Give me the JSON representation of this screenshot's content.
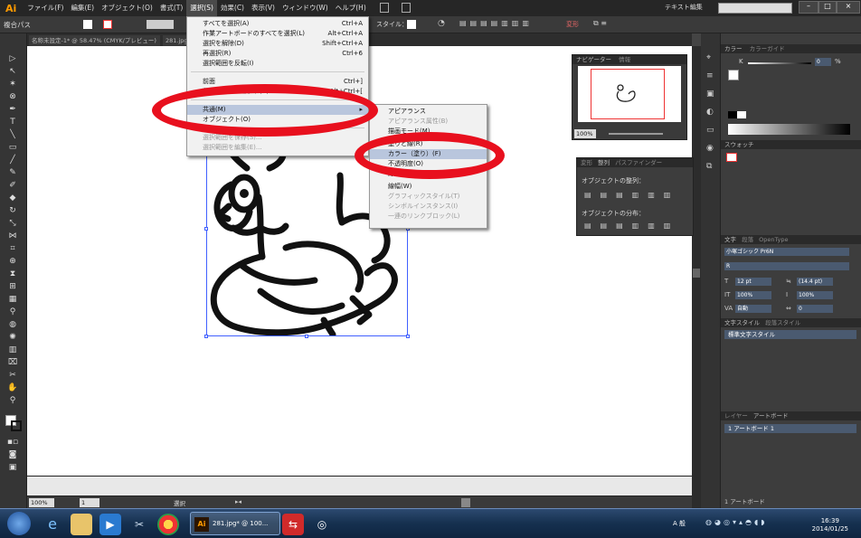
{
  "menubar": {
    "logo": "Ai",
    "items": [
      "ファイル(F)",
      "編集(E)",
      "オブジェクト(O)",
      "書式(T)",
      "選択(S)",
      "効果(C)",
      "表示(V)",
      "ウィンドウ(W)",
      "ヘルプ(H)"
    ],
    "workspace": "テキスト編集",
    "active_index": 4
  },
  "controlbar": {
    "label": "複合パス",
    "style_label": "スタイル：",
    "transform": "変形"
  },
  "document_tabs": [
    "名称未設定-1* @ 58.47% (CMYK/プレビュー)",
    "281.jpg*"
  ],
  "select_menu": {
    "items": [
      {
        "label": "すべてを選択(A)",
        "shortcut": "Ctrl+A"
      },
      {
        "label": "作業アートボードのすべてを選択(L)",
        "shortcut": "Alt+Ctrl+A"
      },
      {
        "label": "選択を解除(D)",
        "shortcut": "Shift+Ctrl+A"
      },
      {
        "label": "再選択(R)",
        "shortcut": "Ctrl+6"
      },
      {
        "label": "選択範囲を反転(I)",
        "shortcut": ""
      },
      {
        "label": "前面",
        "shortcut": "Ctrl+]"
      },
      {
        "label": "背面のオブジェクト(B)",
        "shortcut": "Alt+Ctrl+["
      },
      {
        "label": "共通(M)",
        "shortcut": ""
      },
      {
        "label": "オブジェクト(O)",
        "shortcut": ""
      },
      {
        "label": "選択範囲を保存(S)...",
        "shortcut": ""
      },
      {
        "label": "選択範囲を編集(E)...",
        "shortcut": ""
      }
    ]
  },
  "submenu": {
    "items": [
      "アピアランス",
      "アピアランス属性(B)",
      "描画モード(M)",
      "塗りと線(R)",
      "カラー（塗り）(F)",
      "不透明度(O)",
      "線カラー(S)",
      "線幅(W)",
      "グラフィックスタイル(T)",
      "シンボルインスタンス(I)",
      "一連のリンクブロック(L)"
    ]
  },
  "navigator": {
    "tabs": [
      "ナビゲーター",
      "情報"
    ],
    "zoom": "100%"
  },
  "align_panel": {
    "tabs": [
      "変形",
      "整列",
      "パスファインダー"
    ],
    "align_label": "オブジェクトの整列：",
    "distribute_label": "オブジェクトの分布："
  },
  "right_panel": {
    "color_tabs": [
      "カラー",
      "カラーガイド"
    ],
    "k_label": "K",
    "k_value": "0",
    "k_unit": "%",
    "swatch_tab": "スウォッチ",
    "char_tabs": [
      "文字",
      "段落",
      "OpenType"
    ],
    "font_name": "小塚ゴシック Pr6N",
    "font_style": "R",
    "font_size": "12 pt",
    "leading": "(14.4 pt)",
    "h_scale": "100%",
    "v_scale": "100%",
    "auto_label": "自動",
    "tracking": "0",
    "charstyle_tabs": [
      "文字スタイル",
      "段落スタイル"
    ],
    "charstyle_item": "標準文字スタイル",
    "layer_tabs": [
      "レイヤー",
      "アートボード"
    ],
    "artboard_item": "1  アートボード 1",
    "artboard_num": "1",
    "artboard_count": "1 アートボード"
  },
  "status": {
    "zoom": "100%",
    "page": "1",
    "mode": "選択"
  },
  "taskbar": {
    "app_label": "281.jpg* @ 100...",
    "time": "16:39",
    "date": "2014/01/25",
    "ime": "A 般"
  },
  "colors": {
    "accent": "#ff9a00",
    "highlight": "#b9c6dd",
    "annotation_red": "#e8101e"
  }
}
